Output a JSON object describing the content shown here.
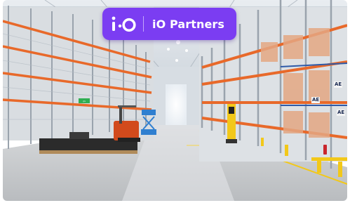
{
  "brand": {
    "name": "iO Partners",
    "logo_mark": "i·O",
    "badge_color": "#7b3df2"
  },
  "scene": {
    "subject": "warehouse-interior",
    "rack_labels": [
      "AE",
      "AE",
      "AE"
    ],
    "colors": {
      "rack_beam": "#e8692a",
      "rack_upright": "#9aa3ad",
      "floor": "#c9cccf",
      "forklift": "#d24a1c",
      "pallet_wrap": "#2b2b2b",
      "scissor_lift": "#2f7fd0",
      "safety_yellow": "#f2c81a"
    }
  }
}
